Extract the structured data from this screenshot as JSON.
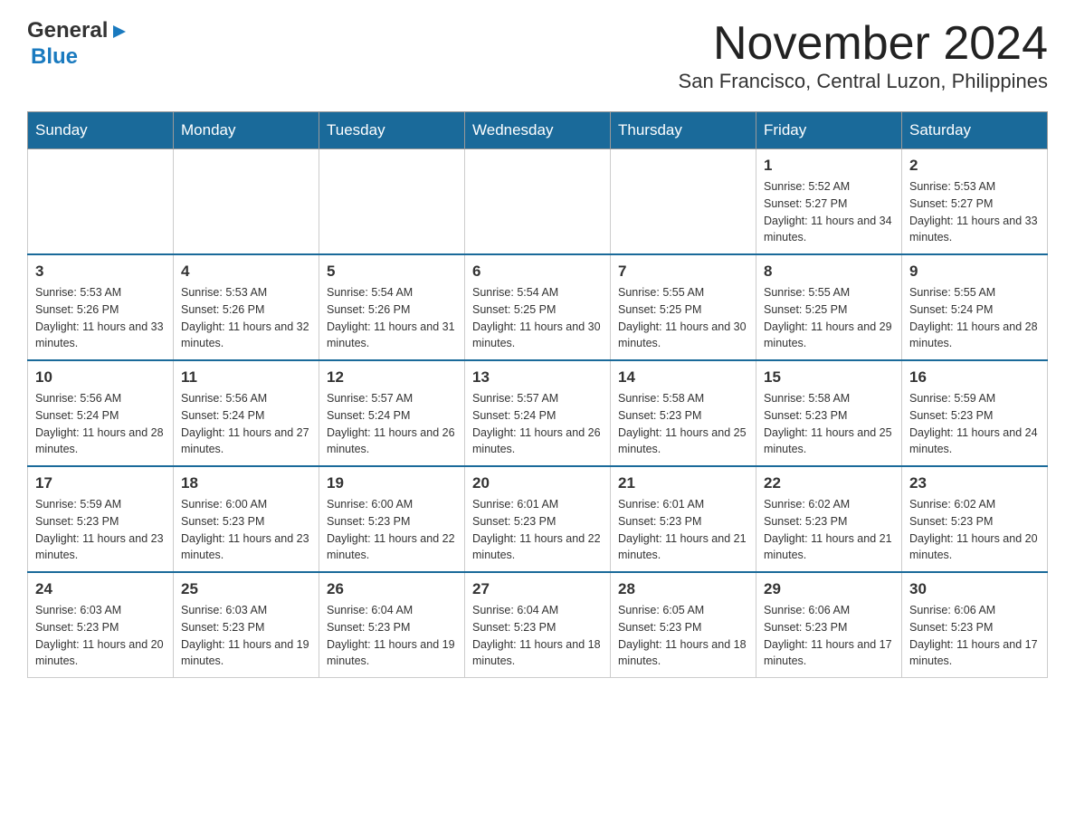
{
  "logo": {
    "general": "General",
    "blue": "Blue",
    "arrow": "▶"
  },
  "header": {
    "title": "November 2024",
    "subtitle": "San Francisco, Central Luzon, Philippines"
  },
  "days_of_week": [
    "Sunday",
    "Monday",
    "Tuesday",
    "Wednesday",
    "Thursday",
    "Friday",
    "Saturday"
  ],
  "weeks": [
    [
      {
        "day": "",
        "info": "",
        "empty": true
      },
      {
        "day": "",
        "info": "",
        "empty": true
      },
      {
        "day": "",
        "info": "",
        "empty": true
      },
      {
        "day": "",
        "info": "",
        "empty": true
      },
      {
        "day": "",
        "info": "",
        "empty": true
      },
      {
        "day": "1",
        "info": "Sunrise: 5:52 AM\nSunset: 5:27 PM\nDaylight: 11 hours and 34 minutes.",
        "empty": false
      },
      {
        "day": "2",
        "info": "Sunrise: 5:53 AM\nSunset: 5:27 PM\nDaylight: 11 hours and 33 minutes.",
        "empty": false
      }
    ],
    [
      {
        "day": "3",
        "info": "Sunrise: 5:53 AM\nSunset: 5:26 PM\nDaylight: 11 hours and 33 minutes.",
        "empty": false
      },
      {
        "day": "4",
        "info": "Sunrise: 5:53 AM\nSunset: 5:26 PM\nDaylight: 11 hours and 32 minutes.",
        "empty": false
      },
      {
        "day": "5",
        "info": "Sunrise: 5:54 AM\nSunset: 5:26 PM\nDaylight: 11 hours and 31 minutes.",
        "empty": false
      },
      {
        "day": "6",
        "info": "Sunrise: 5:54 AM\nSunset: 5:25 PM\nDaylight: 11 hours and 30 minutes.",
        "empty": false
      },
      {
        "day": "7",
        "info": "Sunrise: 5:55 AM\nSunset: 5:25 PM\nDaylight: 11 hours and 30 minutes.",
        "empty": false
      },
      {
        "day": "8",
        "info": "Sunrise: 5:55 AM\nSunset: 5:25 PM\nDaylight: 11 hours and 29 minutes.",
        "empty": false
      },
      {
        "day": "9",
        "info": "Sunrise: 5:55 AM\nSunset: 5:24 PM\nDaylight: 11 hours and 28 minutes.",
        "empty": false
      }
    ],
    [
      {
        "day": "10",
        "info": "Sunrise: 5:56 AM\nSunset: 5:24 PM\nDaylight: 11 hours and 28 minutes.",
        "empty": false
      },
      {
        "day": "11",
        "info": "Sunrise: 5:56 AM\nSunset: 5:24 PM\nDaylight: 11 hours and 27 minutes.",
        "empty": false
      },
      {
        "day": "12",
        "info": "Sunrise: 5:57 AM\nSunset: 5:24 PM\nDaylight: 11 hours and 26 minutes.",
        "empty": false
      },
      {
        "day": "13",
        "info": "Sunrise: 5:57 AM\nSunset: 5:24 PM\nDaylight: 11 hours and 26 minutes.",
        "empty": false
      },
      {
        "day": "14",
        "info": "Sunrise: 5:58 AM\nSunset: 5:23 PM\nDaylight: 11 hours and 25 minutes.",
        "empty": false
      },
      {
        "day": "15",
        "info": "Sunrise: 5:58 AM\nSunset: 5:23 PM\nDaylight: 11 hours and 25 minutes.",
        "empty": false
      },
      {
        "day": "16",
        "info": "Sunrise: 5:59 AM\nSunset: 5:23 PM\nDaylight: 11 hours and 24 minutes.",
        "empty": false
      }
    ],
    [
      {
        "day": "17",
        "info": "Sunrise: 5:59 AM\nSunset: 5:23 PM\nDaylight: 11 hours and 23 minutes.",
        "empty": false
      },
      {
        "day": "18",
        "info": "Sunrise: 6:00 AM\nSunset: 5:23 PM\nDaylight: 11 hours and 23 minutes.",
        "empty": false
      },
      {
        "day": "19",
        "info": "Sunrise: 6:00 AM\nSunset: 5:23 PM\nDaylight: 11 hours and 22 minutes.",
        "empty": false
      },
      {
        "day": "20",
        "info": "Sunrise: 6:01 AM\nSunset: 5:23 PM\nDaylight: 11 hours and 22 minutes.",
        "empty": false
      },
      {
        "day": "21",
        "info": "Sunrise: 6:01 AM\nSunset: 5:23 PM\nDaylight: 11 hours and 21 minutes.",
        "empty": false
      },
      {
        "day": "22",
        "info": "Sunrise: 6:02 AM\nSunset: 5:23 PM\nDaylight: 11 hours and 21 minutes.",
        "empty": false
      },
      {
        "day": "23",
        "info": "Sunrise: 6:02 AM\nSunset: 5:23 PM\nDaylight: 11 hours and 20 minutes.",
        "empty": false
      }
    ],
    [
      {
        "day": "24",
        "info": "Sunrise: 6:03 AM\nSunset: 5:23 PM\nDaylight: 11 hours and 20 minutes.",
        "empty": false
      },
      {
        "day": "25",
        "info": "Sunrise: 6:03 AM\nSunset: 5:23 PM\nDaylight: 11 hours and 19 minutes.",
        "empty": false
      },
      {
        "day": "26",
        "info": "Sunrise: 6:04 AM\nSunset: 5:23 PM\nDaylight: 11 hours and 19 minutes.",
        "empty": false
      },
      {
        "day": "27",
        "info": "Sunrise: 6:04 AM\nSunset: 5:23 PM\nDaylight: 11 hours and 18 minutes.",
        "empty": false
      },
      {
        "day": "28",
        "info": "Sunrise: 6:05 AM\nSunset: 5:23 PM\nDaylight: 11 hours and 18 minutes.",
        "empty": false
      },
      {
        "day": "29",
        "info": "Sunrise: 6:06 AM\nSunset: 5:23 PM\nDaylight: 11 hours and 17 minutes.",
        "empty": false
      },
      {
        "day": "30",
        "info": "Sunrise: 6:06 AM\nSunset: 5:23 PM\nDaylight: 11 hours and 17 minutes.",
        "empty": false
      }
    ]
  ]
}
